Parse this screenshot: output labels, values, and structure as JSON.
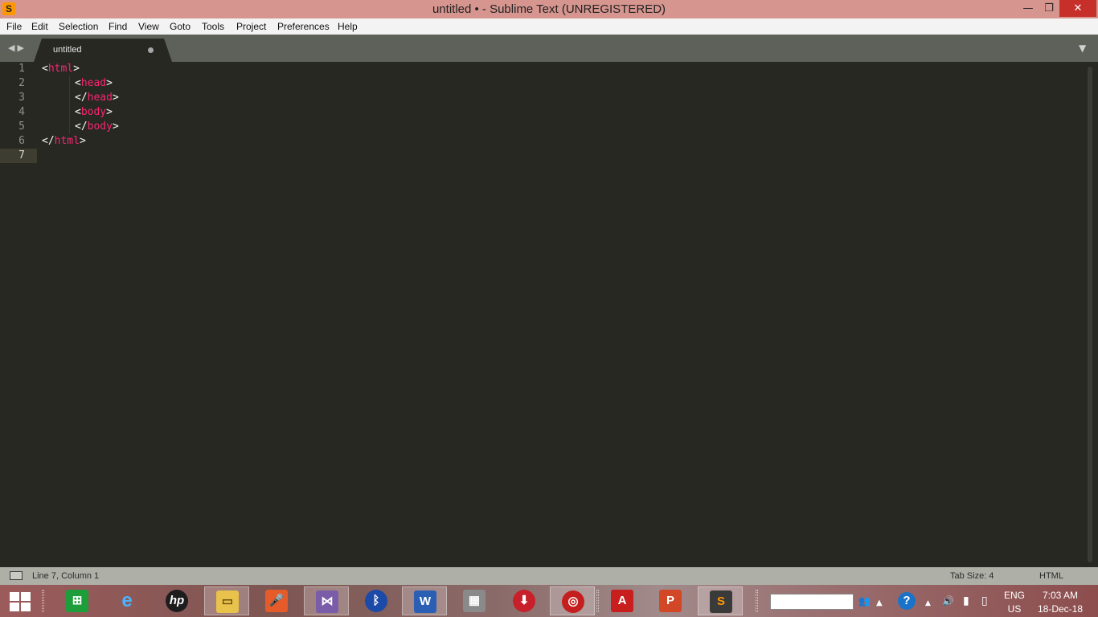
{
  "window": {
    "title": "untitled • - Sublime Text (UNREGISTERED)",
    "app_icon_glyph": "S",
    "minimize_glyph": "—",
    "maximize_glyph": "❐",
    "close_glyph": "✕"
  },
  "menu": {
    "items": [
      "File",
      "Edit",
      "Selection",
      "Find",
      "View",
      "Goto",
      "Tools",
      "Project",
      "Preferences",
      "Help"
    ]
  },
  "tabs": {
    "nav_arrows": "◀▶",
    "dropdown_glyph": "▼",
    "items": [
      {
        "label": "untitled",
        "dirty": true
      }
    ]
  },
  "editor": {
    "line_numbers": [
      "1",
      "2",
      "3",
      "4",
      "5",
      "6",
      "7"
    ],
    "current_line": 7,
    "lines": [
      {
        "open": "<",
        "tag": "html",
        "close": ">"
      },
      {
        "open": "<",
        "tag": "head",
        "close": ">"
      },
      {
        "open": "</",
        "tag": "head",
        "close": ">"
      },
      {
        "open": "<",
        "tag": "body",
        "close": ">"
      },
      {
        "open": "</",
        "tag": "body",
        "close": ">"
      },
      {
        "open": "</",
        "tag": "html",
        "close": ">"
      }
    ],
    "colors": {
      "background": "#272822",
      "tag": "#f92672",
      "text": "#f8f8f2",
      "line_number": "#8f908a"
    }
  },
  "statusbar": {
    "position": "Line 7, Column 1",
    "tab_size": "Tab Size: 4",
    "syntax": "HTML"
  },
  "taskbar": {
    "apps": [
      {
        "name": "store-app",
        "glyph": "⊞",
        "color": "#1e9e3a"
      },
      {
        "name": "internet-explorer-app",
        "glyph": "e",
        "color": "#1a7fd4"
      },
      {
        "name": "hp-app",
        "glyph": "hp",
        "color": "#1d1d1d"
      },
      {
        "name": "file-explorer-app",
        "glyph": "▭",
        "color": "#e8c24a"
      },
      {
        "name": "voice-recorder-app",
        "glyph": "🎤",
        "color": "#e55b2a"
      },
      {
        "name": "visual-studio-app",
        "glyph": "⋈",
        "color": "#7a5ca8"
      },
      {
        "name": "bluetooth-app",
        "glyph": "ᛒ",
        "color": "#1c4aa8"
      },
      {
        "name": "word-app",
        "glyph": "W",
        "color": "#2b5fb4"
      },
      {
        "name": "firewall-app",
        "glyph": "▦",
        "color": "#8a8a8a"
      },
      {
        "name": "downloader-app",
        "glyph": "⬇",
        "color": "#c8202a"
      },
      {
        "name": "cd-burner-app",
        "glyph": "◎",
        "color": "#c41e1e"
      },
      {
        "name": "acrobat-app",
        "glyph": "A",
        "color": "#c81e1e"
      },
      {
        "name": "powerpoint-app",
        "glyph": "P",
        "color": "#d24726"
      },
      {
        "name": "sublime-text-app",
        "glyph": "S",
        "color": "#3a3a3a"
      }
    ],
    "tray": {
      "language": "ENG",
      "region": "US",
      "time": "7:03 AM",
      "date": "18-Dec-18",
      "help_glyph": "?",
      "up_glyph": "▲",
      "volume_glyph": "🔊",
      "network_glyph": "▮",
      "power_glyph": "▯",
      "people_glyph": "👥"
    }
  }
}
